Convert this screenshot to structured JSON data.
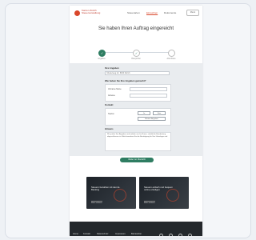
{
  "header": {
    "brand": "Kanton Zürich Steuerverwaltung",
    "nav": [
      "Steuerarten",
      "Einreichen",
      "Dokumente"
    ],
    "menu_label": "Menü"
  },
  "title": "Sie haben Ihren Auftrag eingereicht",
  "steps": {
    "labels": [
      "Angaben",
      "Überprüfen",
      "Abschluss"
    ],
    "active_index": 0
  },
  "form": {
    "section1": "Ihre Angaben",
    "field1_value": "Musterweg 12, 8000 Zürich",
    "section2": "Wie haben Sie Ihre Angaben gemacht?",
    "label_a": "Vorname Name",
    "label_b": "Adresse",
    "section3": "Kontakt",
    "label_c": "Telefon",
    "btn_yes": "Ja",
    "btn_no": "Nein",
    "btn_add": "Weitere Angaben",
    "section4": "Hinweis",
    "note": "Wir prüfen Ihre Angaben und melden uns bei Ihnen, sobald die Bearbeitung abgeschlossen ist. Bitte bewahren Sie die Bestätigung für Ihre Unterlagen auf."
  },
  "cta_label": "Weiter zur Übersicht",
  "promos": [
    {
      "title": "Steuern bezahlen mit dem E-Banking",
      "link": "Mehr erfahren"
    },
    {
      "title": "Steuern einfach und bequem online erledigen",
      "link": "Mehr erfahren"
    }
  ],
  "footer": {
    "items": [
      "Home",
      "Kontakt",
      "Datenschutz",
      "Impressum",
      "Barrierefrei"
    ]
  },
  "colors": {
    "accent": "#2f7d62",
    "brand": "#d9472b",
    "footer": "#24282c"
  }
}
